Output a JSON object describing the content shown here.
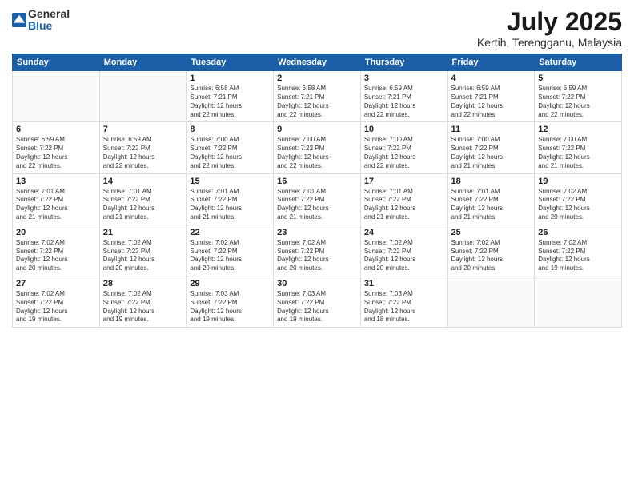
{
  "logo": {
    "general": "General",
    "blue": "Blue"
  },
  "title": "July 2025",
  "location": "Kertih, Terengganu, Malaysia",
  "headers": [
    "Sunday",
    "Monday",
    "Tuesday",
    "Wednesday",
    "Thursday",
    "Friday",
    "Saturday"
  ],
  "weeks": [
    [
      {
        "day": "",
        "info": ""
      },
      {
        "day": "",
        "info": ""
      },
      {
        "day": "1",
        "info": "Sunrise: 6:58 AM\nSunset: 7:21 PM\nDaylight: 12 hours\nand 22 minutes."
      },
      {
        "day": "2",
        "info": "Sunrise: 6:58 AM\nSunset: 7:21 PM\nDaylight: 12 hours\nand 22 minutes."
      },
      {
        "day": "3",
        "info": "Sunrise: 6:59 AM\nSunset: 7:21 PM\nDaylight: 12 hours\nand 22 minutes."
      },
      {
        "day": "4",
        "info": "Sunrise: 6:59 AM\nSunset: 7:21 PM\nDaylight: 12 hours\nand 22 minutes."
      },
      {
        "day": "5",
        "info": "Sunrise: 6:59 AM\nSunset: 7:22 PM\nDaylight: 12 hours\nand 22 minutes."
      }
    ],
    [
      {
        "day": "6",
        "info": "Sunrise: 6:59 AM\nSunset: 7:22 PM\nDaylight: 12 hours\nand 22 minutes."
      },
      {
        "day": "7",
        "info": "Sunrise: 6:59 AM\nSunset: 7:22 PM\nDaylight: 12 hours\nand 22 minutes."
      },
      {
        "day": "8",
        "info": "Sunrise: 7:00 AM\nSunset: 7:22 PM\nDaylight: 12 hours\nand 22 minutes."
      },
      {
        "day": "9",
        "info": "Sunrise: 7:00 AM\nSunset: 7:22 PM\nDaylight: 12 hours\nand 22 minutes."
      },
      {
        "day": "10",
        "info": "Sunrise: 7:00 AM\nSunset: 7:22 PM\nDaylight: 12 hours\nand 22 minutes."
      },
      {
        "day": "11",
        "info": "Sunrise: 7:00 AM\nSunset: 7:22 PM\nDaylight: 12 hours\nand 21 minutes."
      },
      {
        "day": "12",
        "info": "Sunrise: 7:00 AM\nSunset: 7:22 PM\nDaylight: 12 hours\nand 21 minutes."
      }
    ],
    [
      {
        "day": "13",
        "info": "Sunrise: 7:01 AM\nSunset: 7:22 PM\nDaylight: 12 hours\nand 21 minutes."
      },
      {
        "day": "14",
        "info": "Sunrise: 7:01 AM\nSunset: 7:22 PM\nDaylight: 12 hours\nand 21 minutes."
      },
      {
        "day": "15",
        "info": "Sunrise: 7:01 AM\nSunset: 7:22 PM\nDaylight: 12 hours\nand 21 minutes."
      },
      {
        "day": "16",
        "info": "Sunrise: 7:01 AM\nSunset: 7:22 PM\nDaylight: 12 hours\nand 21 minutes."
      },
      {
        "day": "17",
        "info": "Sunrise: 7:01 AM\nSunset: 7:22 PM\nDaylight: 12 hours\nand 21 minutes."
      },
      {
        "day": "18",
        "info": "Sunrise: 7:01 AM\nSunset: 7:22 PM\nDaylight: 12 hours\nand 21 minutes."
      },
      {
        "day": "19",
        "info": "Sunrise: 7:02 AM\nSunset: 7:22 PM\nDaylight: 12 hours\nand 20 minutes."
      }
    ],
    [
      {
        "day": "20",
        "info": "Sunrise: 7:02 AM\nSunset: 7:22 PM\nDaylight: 12 hours\nand 20 minutes."
      },
      {
        "day": "21",
        "info": "Sunrise: 7:02 AM\nSunset: 7:22 PM\nDaylight: 12 hours\nand 20 minutes."
      },
      {
        "day": "22",
        "info": "Sunrise: 7:02 AM\nSunset: 7:22 PM\nDaylight: 12 hours\nand 20 minutes."
      },
      {
        "day": "23",
        "info": "Sunrise: 7:02 AM\nSunset: 7:22 PM\nDaylight: 12 hours\nand 20 minutes."
      },
      {
        "day": "24",
        "info": "Sunrise: 7:02 AM\nSunset: 7:22 PM\nDaylight: 12 hours\nand 20 minutes."
      },
      {
        "day": "25",
        "info": "Sunrise: 7:02 AM\nSunset: 7:22 PM\nDaylight: 12 hours\nand 20 minutes."
      },
      {
        "day": "26",
        "info": "Sunrise: 7:02 AM\nSunset: 7:22 PM\nDaylight: 12 hours\nand 19 minutes."
      }
    ],
    [
      {
        "day": "27",
        "info": "Sunrise: 7:02 AM\nSunset: 7:22 PM\nDaylight: 12 hours\nand 19 minutes."
      },
      {
        "day": "28",
        "info": "Sunrise: 7:02 AM\nSunset: 7:22 PM\nDaylight: 12 hours\nand 19 minutes."
      },
      {
        "day": "29",
        "info": "Sunrise: 7:03 AM\nSunset: 7:22 PM\nDaylight: 12 hours\nand 19 minutes."
      },
      {
        "day": "30",
        "info": "Sunrise: 7:03 AM\nSunset: 7:22 PM\nDaylight: 12 hours\nand 19 minutes."
      },
      {
        "day": "31",
        "info": "Sunrise: 7:03 AM\nSunset: 7:22 PM\nDaylight: 12 hours\nand 18 minutes."
      },
      {
        "day": "",
        "info": ""
      },
      {
        "day": "",
        "info": ""
      }
    ]
  ]
}
